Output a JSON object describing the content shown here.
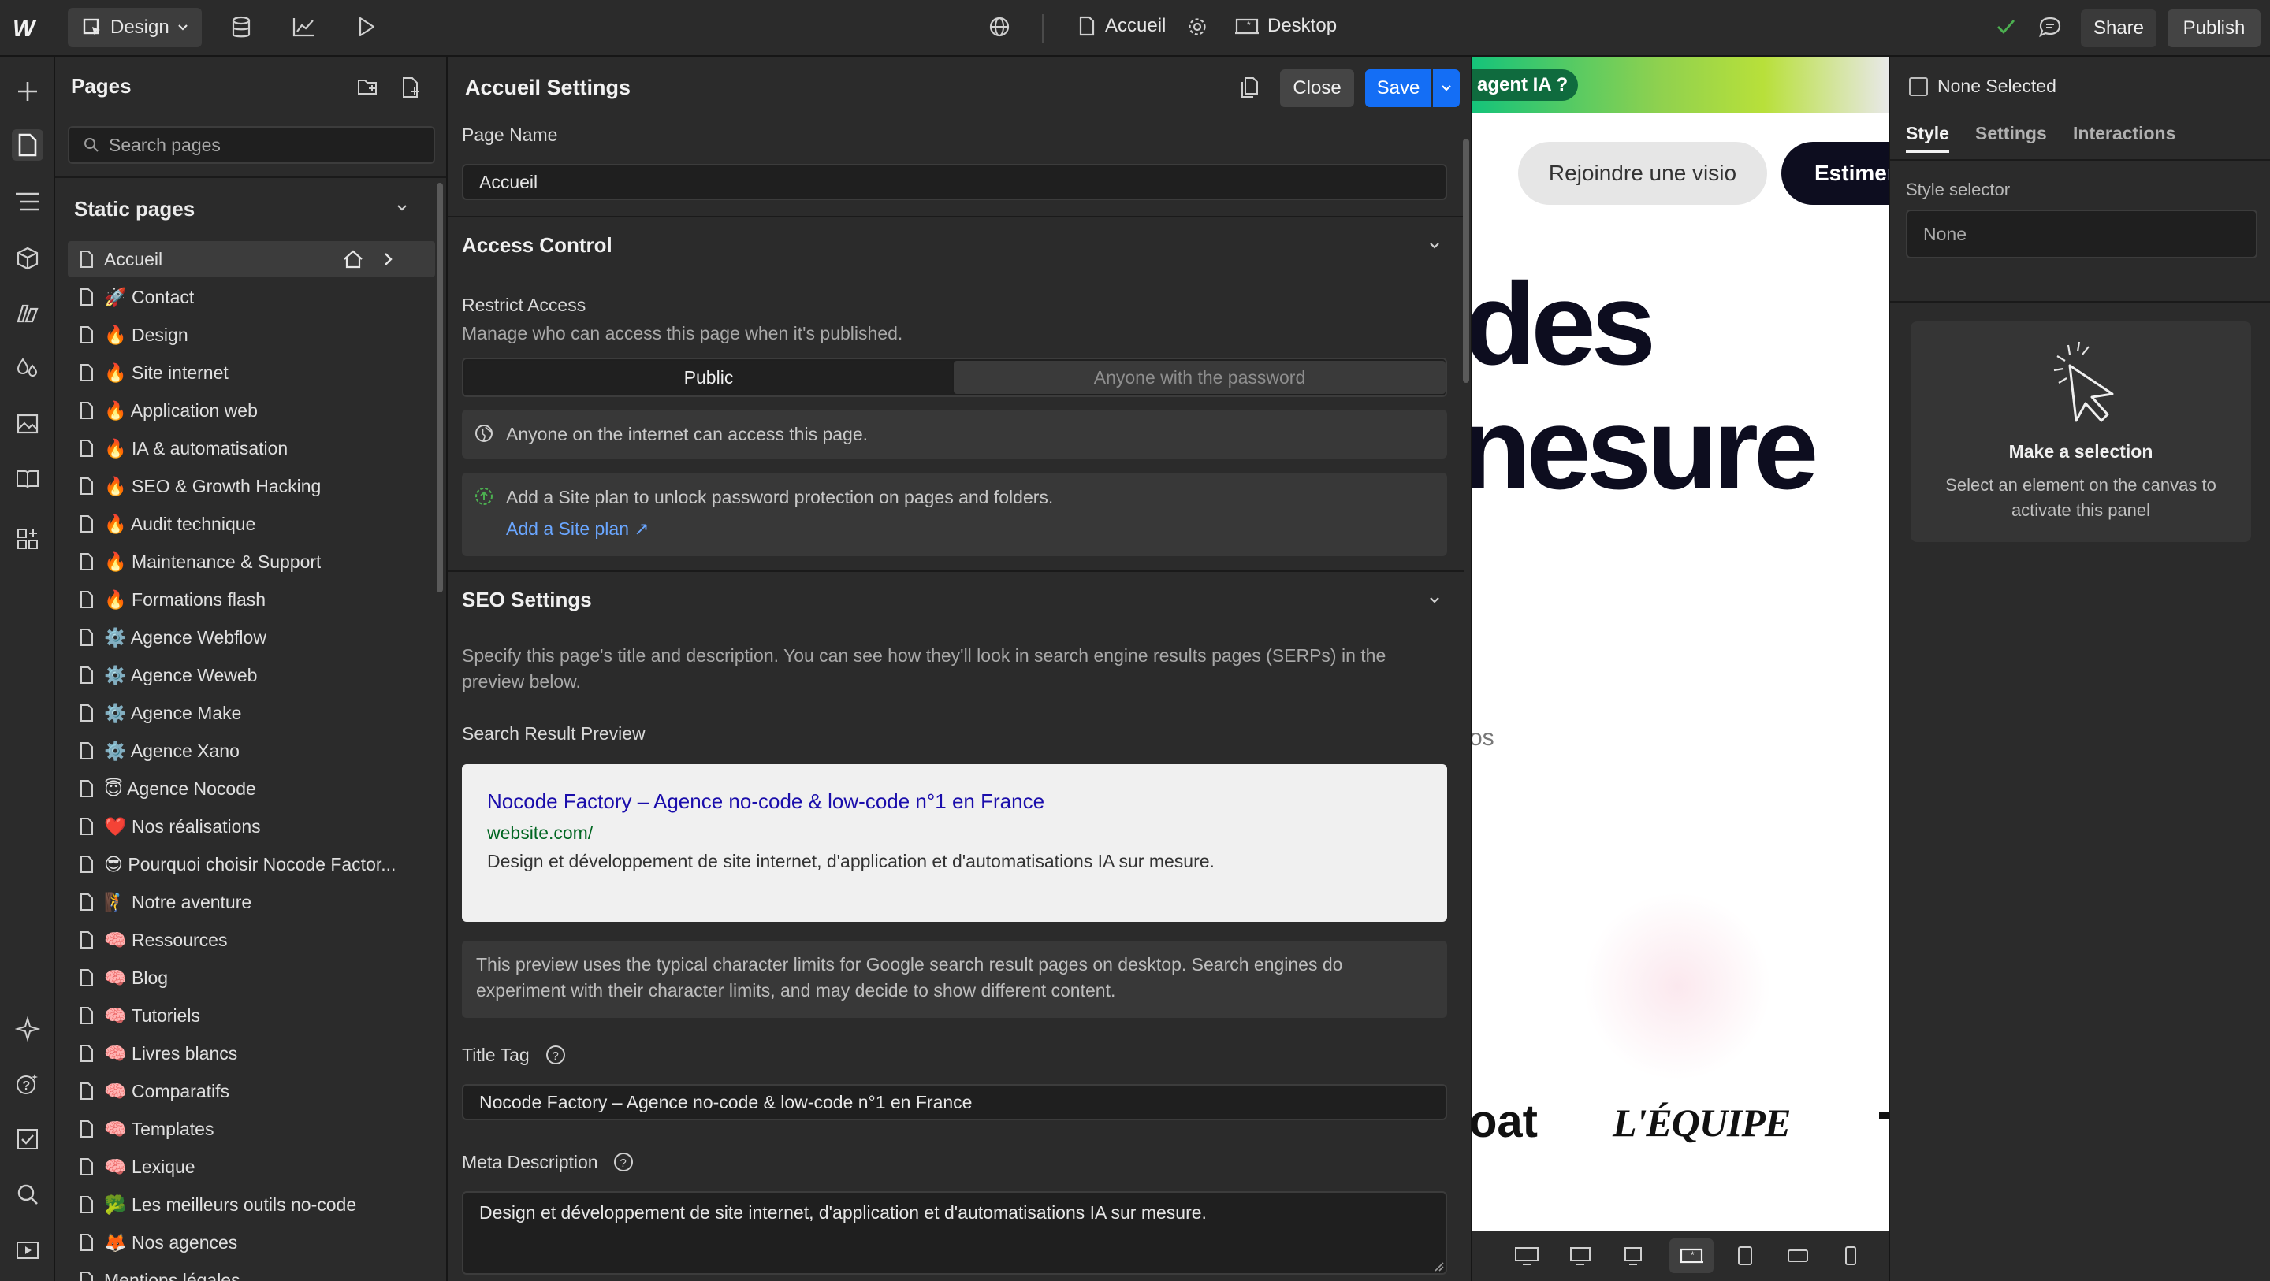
{
  "topbar": {
    "mode_label": "Design",
    "page_label": "Accueil",
    "breakpoint_label": "Desktop",
    "share_label": "Share",
    "publish_label": "Publish"
  },
  "pages_panel": {
    "title": "Pages",
    "search_placeholder": "Search pages",
    "section_title": "Static pages",
    "items": [
      {
        "label": "Accueil"
      },
      {
        "label": "🚀 Contact"
      },
      {
        "label": "🔥 Design"
      },
      {
        "label": "🔥 Site internet"
      },
      {
        "label": "🔥 Application web"
      },
      {
        "label": "🔥 IA & automatisation"
      },
      {
        "label": "🔥 SEO & Growth Hacking"
      },
      {
        "label": "🔥 Audit technique"
      },
      {
        "label": "🔥 Maintenance & Support"
      },
      {
        "label": "🔥 Formations flash"
      },
      {
        "label": "⚙️ Agence Webflow"
      },
      {
        "label": "⚙️ Agence Weweb"
      },
      {
        "label": "⚙️ Agence Make"
      },
      {
        "label": "⚙️ Agence Xano"
      },
      {
        "label": "😇 Agence Nocode"
      },
      {
        "label": "❤️ Nos réalisations"
      },
      {
        "label": "😎 Pourquoi choisir Nocode Factor..."
      },
      {
        "label": "🧗 Notre aventure"
      },
      {
        "label": "🧠 Ressources"
      },
      {
        "label": "🧠 Blog"
      },
      {
        "label": "🧠 Tutoriels"
      },
      {
        "label": "🧠 Livres blancs"
      },
      {
        "label": "🧠 Comparatifs"
      },
      {
        "label": "🧠 Templates"
      },
      {
        "label": "🧠 Lexique"
      },
      {
        "label": "🥦 Les meilleurs outils no-code"
      },
      {
        "label": "🦊 Nos agences"
      },
      {
        "label": "Mentions légales"
      }
    ]
  },
  "settings": {
    "title": "Accueil Settings",
    "close_label": "Close",
    "save_label": "Save",
    "page_name_label": "Page Name",
    "page_name_value": "Accueil",
    "access": {
      "title": "Access Control",
      "restrict_label": "Restrict Access",
      "restrict_desc": "Manage who can access this page when it's published.",
      "option_public": "Public",
      "option_password": "Anyone with the password",
      "public_note": "Anyone on the internet can access this page.",
      "plan_note": "Add a Site plan to unlock password protection on pages and folders.",
      "plan_link": "Add a Site plan ↗"
    },
    "seo": {
      "title": "SEO Settings",
      "desc": "Specify this page's title and description. You can see how they'll look in search engine results pages (SERPs) in the preview below.",
      "preview_label": "Search Result Preview",
      "preview_title": "Nocode Factory – Agence no-code & low-code n°1 en France",
      "preview_url": "website.com/",
      "preview_desc": "Design et développement de site internet, d'application et d'automatisations IA sur mesure.",
      "preview_note": "This preview uses the typical character limits for Google search result pages on desktop. Search engines do experiment with their character limits, and may decide to show different content.",
      "title_tag_label": "Title Tag",
      "title_tag_value": "Nocode Factory – Agence no-code & low-code n°1 en France",
      "meta_label": "Meta Description",
      "meta_value": "Design et développement de site internet, d'application et d'automatisations IA sur mesure."
    }
  },
  "canvas": {
    "banner_text": "agent IA ?",
    "btn_visio": "Rejoindre une visio",
    "btn_estimer": "Estimer",
    "hero_line1": "des",
    "hero_line2": "nesure",
    "small_text": "os",
    "logo1": "oat",
    "logo2": "L'ÉQUIPE"
  },
  "right_panel": {
    "none_selected": "None Selected",
    "tab_style": "Style",
    "tab_settings": "Settings",
    "tab_interactions": "Interactions",
    "style_selector_label": "Style selector",
    "style_selector_placeholder": "None",
    "empty_title": "Make a selection",
    "empty_desc": "Select an element on the canvas to activate this panel"
  },
  "colors": {
    "accent": "#146ef5",
    "link": "#6aa6ff",
    "serp_title": "#1a0dab",
    "serp_url": "#006621",
    "success": "#4caf50"
  }
}
